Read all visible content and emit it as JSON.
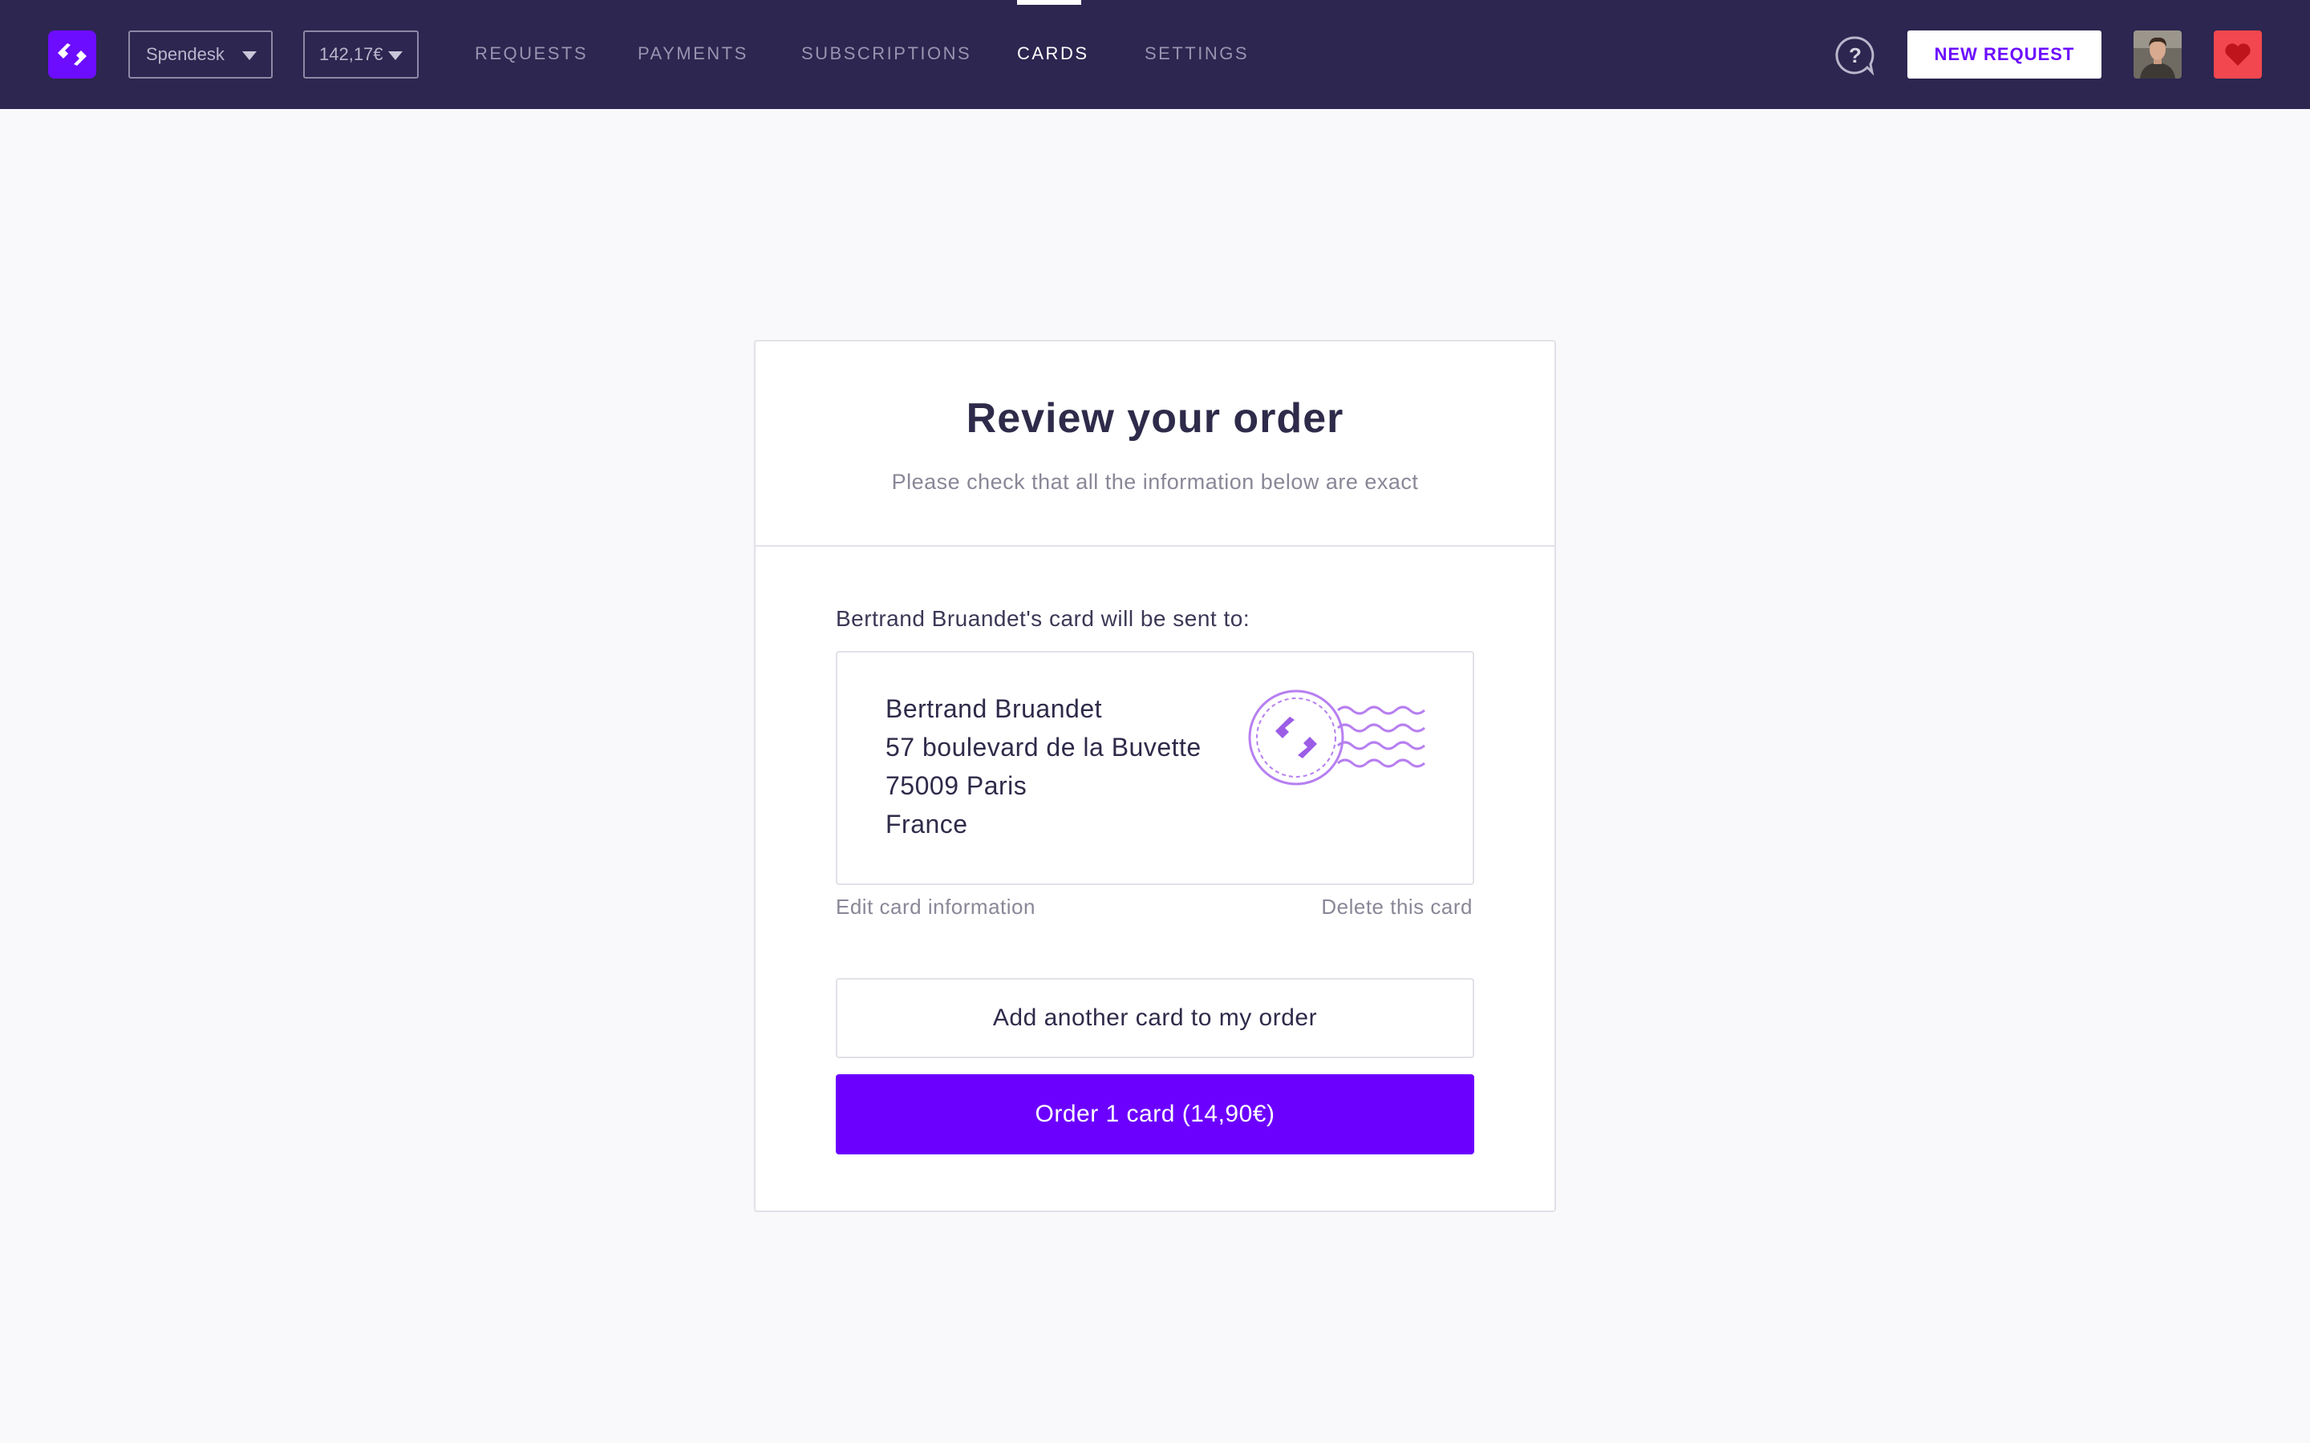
{
  "topbar": {
    "logo_icon": "spendesk-logo-icon",
    "company_select": {
      "value": "Spendesk"
    },
    "balance_select": {
      "value": "142,17€"
    },
    "nav": [
      {
        "label": "REQUESTS",
        "active": false
      },
      {
        "label": "PAYMENTS",
        "active": false
      },
      {
        "label": "SUBSCRIPTIONS",
        "active": false
      },
      {
        "label": "CARDS",
        "active": true
      },
      {
        "label": "SETTINGS",
        "active": false
      }
    ],
    "help_icon": "help-chat-icon",
    "new_request_label": "NEW REQUEST",
    "heart_icon": "heart-icon"
  },
  "order": {
    "title": "Review your order",
    "subtitle": "Please check that all the information below are exact",
    "sent_to": "Bertrand Bruandet's card will be sent to:",
    "address": {
      "name": "Bertrand Bruandet",
      "street": "57 boulevard de la Buvette",
      "city": "75009 Paris",
      "country": "France"
    },
    "edit_link": "Edit card information",
    "delete_link": "Delete this card",
    "add_card_label": "Add another card to my order",
    "order_label": "Order 1 card (14,90€)"
  },
  "colors": {
    "topbar": "#2c2650",
    "accent": "#6c00ff",
    "heart": "#f2474f",
    "page_bg": "#f9f9fb"
  }
}
